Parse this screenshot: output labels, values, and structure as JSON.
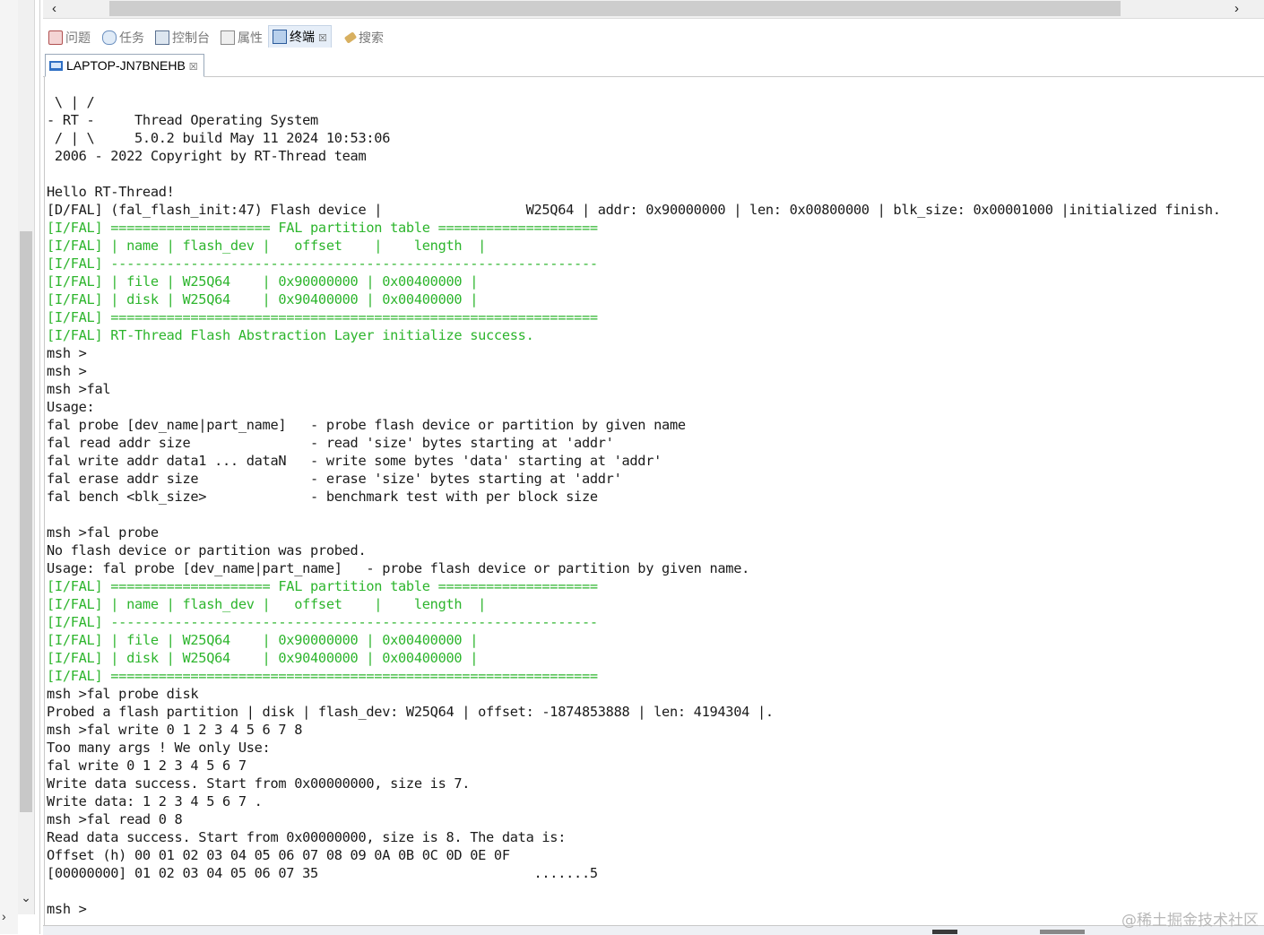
{
  "scrollbar": {
    "left_arrow": "‹",
    "right_arrow": "›",
    "down_arrow": "⌄",
    "side_arrow": "›"
  },
  "view_tabs": [
    {
      "label": "问题",
      "icon": "problems-icon"
    },
    {
      "label": "任务",
      "icon": "tasks-icon"
    },
    {
      "label": "控制台",
      "icon": "console-icon"
    },
    {
      "label": "属性",
      "icon": "properties-icon"
    },
    {
      "label": "终端",
      "icon": "terminal-icon",
      "active": true,
      "close": "☒"
    },
    {
      "label": "搜索",
      "icon": "search-icon"
    }
  ],
  "terminal_tab": {
    "title": "LAPTOP-JN7BNEHB",
    "close": "☒"
  },
  "terminal": {
    "lines": [
      {
        "text": " \\ | /",
        "color": "default"
      },
      {
        "text": "- RT -     Thread Operating System",
        "color": "default"
      },
      {
        "text": " / | \\     5.0.2 build May 11 2024 10:53:06",
        "color": "default"
      },
      {
        "text": " 2006 - 2022 Copyright by RT-Thread team",
        "color": "default"
      },
      {
        "text": "",
        "color": "default"
      },
      {
        "text": "Hello RT-Thread!",
        "color": "default"
      },
      {
        "text": "[D/FAL] (fal_flash_init:47) Flash device |                  W25Q64 | addr: 0x90000000 | len: 0x00800000 | blk_size: 0x00001000 |initialized finish.",
        "color": "default"
      },
      {
        "text": "[I/FAL] ==================== FAL partition table ====================",
        "color": "green"
      },
      {
        "text": "[I/FAL] | name | flash_dev |   offset    |    length  |",
        "color": "green"
      },
      {
        "text": "[I/FAL] -------------------------------------------------------------",
        "color": "green"
      },
      {
        "text": "[I/FAL] | file | W25Q64    | 0x90000000 | 0x00400000 |",
        "color": "green"
      },
      {
        "text": "[I/FAL] | disk | W25Q64    | 0x90400000 | 0x00400000 |",
        "color": "green"
      },
      {
        "text": "[I/FAL] =============================================================",
        "color": "green"
      },
      {
        "text": "[I/FAL] RT-Thread Flash Abstraction Layer initialize success.",
        "color": "green"
      },
      {
        "text": "msh >",
        "color": "default"
      },
      {
        "text": "msh >",
        "color": "default"
      },
      {
        "text": "msh >fal",
        "color": "default"
      },
      {
        "text": "Usage:",
        "color": "default"
      },
      {
        "text": "fal probe [dev_name|part_name]   - probe flash device or partition by given name",
        "color": "default"
      },
      {
        "text": "fal read addr size               - read 'size' bytes starting at 'addr'",
        "color": "default"
      },
      {
        "text": "fal write addr data1 ... dataN   - write some bytes 'data' starting at 'addr'",
        "color": "default"
      },
      {
        "text": "fal erase addr size              - erase 'size' bytes starting at 'addr'",
        "color": "default"
      },
      {
        "text": "fal bench <blk_size>             - benchmark test with per block size",
        "color": "default"
      },
      {
        "text": "",
        "color": "default"
      },
      {
        "text": "msh >fal probe",
        "color": "default"
      },
      {
        "text": "No flash device or partition was probed.",
        "color": "default"
      },
      {
        "text": "Usage: fal probe [dev_name|part_name]   - probe flash device or partition by given name.",
        "color": "default"
      },
      {
        "text": "[I/FAL] ==================== FAL partition table ====================",
        "color": "green"
      },
      {
        "text": "[I/FAL] | name | flash_dev |   offset    |    length  |",
        "color": "green"
      },
      {
        "text": "[I/FAL] -------------------------------------------------------------",
        "color": "green"
      },
      {
        "text": "[I/FAL] | file | W25Q64    | 0x90000000 | 0x00400000 |",
        "color": "green"
      },
      {
        "text": "[I/FAL] | disk | W25Q64    | 0x90400000 | 0x00400000 |",
        "color": "green"
      },
      {
        "text": "[I/FAL] =============================================================",
        "color": "green"
      },
      {
        "text": "msh >fal probe disk",
        "color": "default"
      },
      {
        "text": "Probed a flash partition | disk | flash_dev: W25Q64 | offset: -1874853888 | len: 4194304 |.",
        "color": "default"
      },
      {
        "text": "msh >fal write 0 1 2 3 4 5 6 7 8",
        "color": "default"
      },
      {
        "text": "Too many args ! We only Use:",
        "color": "default"
      },
      {
        "text": "fal write 0 1 2 3 4 5 6 7",
        "color": "default"
      },
      {
        "text": "Write data success. Start from 0x00000000, size is 7.",
        "color": "default"
      },
      {
        "text": "Write data: 1 2 3 4 5 6 7 .",
        "color": "default"
      },
      {
        "text": "msh >fal read 0 8",
        "color": "default"
      },
      {
        "text": "Read data success. Start from 0x00000000, size is 8. The data is:",
        "color": "default"
      },
      {
        "text": "Offset (h) 00 01 02 03 04 05 06 07 08 09 0A 0B 0C 0D 0E 0F",
        "color": "default"
      },
      {
        "text": "[00000000] 01 02 03 04 05 06 07 35                           .......5",
        "color": "default"
      },
      {
        "text": "",
        "color": "default"
      },
      {
        "text": "msh >",
        "color": "default"
      }
    ]
  },
  "watermark": "@稀土掘金技术社区",
  "colors": {
    "green": "#2db52d",
    "text": "#1a1a1a"
  }
}
